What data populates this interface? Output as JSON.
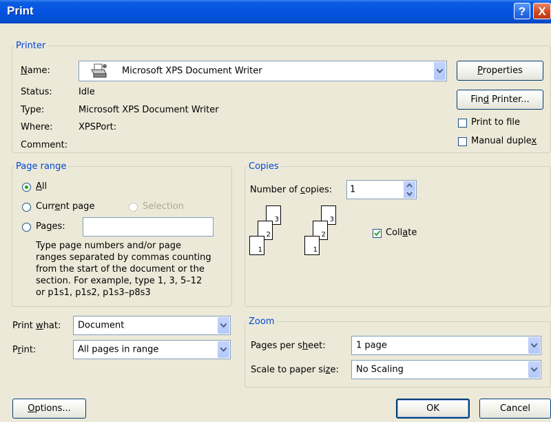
{
  "window": {
    "title": "Print",
    "help_glyph": "?",
    "close_glyph": "X"
  },
  "printer": {
    "legend": "Printer",
    "name_label": {
      "pre": "",
      "ul": "N",
      "post": "ame:"
    },
    "name_value": "Microsoft XPS Document Writer",
    "status_label": "Status:",
    "status_value": "Idle",
    "type_label": "Type:",
    "type_value": "Microsoft XPS Document Writer",
    "where_label": "Where:",
    "where_value": "XPSPort:",
    "comment_label": "Comment:",
    "comment_value": "",
    "properties_button": {
      "pre": "",
      "ul": "P",
      "post": "roperties"
    },
    "find_printer_button": {
      "pre": "Fin",
      "ul": "d",
      "post": " Printer..."
    },
    "print_to_file": {
      "pre": "Print to f",
      "ul": "i",
      "post": "le",
      "checked": false
    },
    "manual_duplex": {
      "pre": "Manual duple",
      "ul": "x",
      "post": "",
      "checked": false
    }
  },
  "page_range": {
    "legend": "Page range",
    "all": {
      "pre": "",
      "ul": "A",
      "post": "ll",
      "selected": true
    },
    "current_page": {
      "pre": "Curr",
      "ul": "e",
      "post": "nt page",
      "selected": false
    },
    "selection": {
      "label": "Selection",
      "disabled": true
    },
    "pages": {
      "pre": "Pa",
      "ul": "g",
      "post": "es:",
      "selected": false,
      "value": ""
    },
    "help_text": [
      "Type page numbers and/or page",
      "ranges separated by commas counting",
      "from the start of the document or the",
      "section. For example, type 1, 3, 5–12",
      "or p1s1, p1s2, p1s3–p8s3"
    ]
  },
  "copies": {
    "legend": "Copies",
    "number_label": {
      "pre": "Number of ",
      "ul": "c",
      "post": "opies:"
    },
    "number_value": "1",
    "collate": {
      "pre": "Coll",
      "ul": "a",
      "post": "te",
      "checked": true
    },
    "page_numbers": [
      "3",
      "2",
      "1"
    ]
  },
  "print_what": {
    "label": {
      "pre": "Print ",
      "ul": "w",
      "post": "hat:"
    },
    "value": "Document"
  },
  "print": {
    "label": {
      "pre": "P",
      "ul": "r",
      "post": "int:"
    },
    "value": "All pages in range"
  },
  "zoom": {
    "legend": "Zoom",
    "pages_per_sheet": {
      "label": {
        "pre": "Pages per s",
        "ul": "h",
        "post": "eet:"
      },
      "value": "1 page"
    },
    "scale": {
      "label": {
        "pre": "Scale to paper si",
        "ul": "z",
        "post": "e:"
      },
      "value": "No Scaling"
    }
  },
  "footer": {
    "options_button": {
      "pre": "",
      "ul": "O",
      "post": "ptions..."
    },
    "ok_button": "OK",
    "cancel_button": "Cancel"
  },
  "colors": {
    "titlebar": "#0554e3",
    "legend": "#0046d5",
    "dialog_bg": "#ece9d8",
    "radio_dot": "#21a121"
  }
}
